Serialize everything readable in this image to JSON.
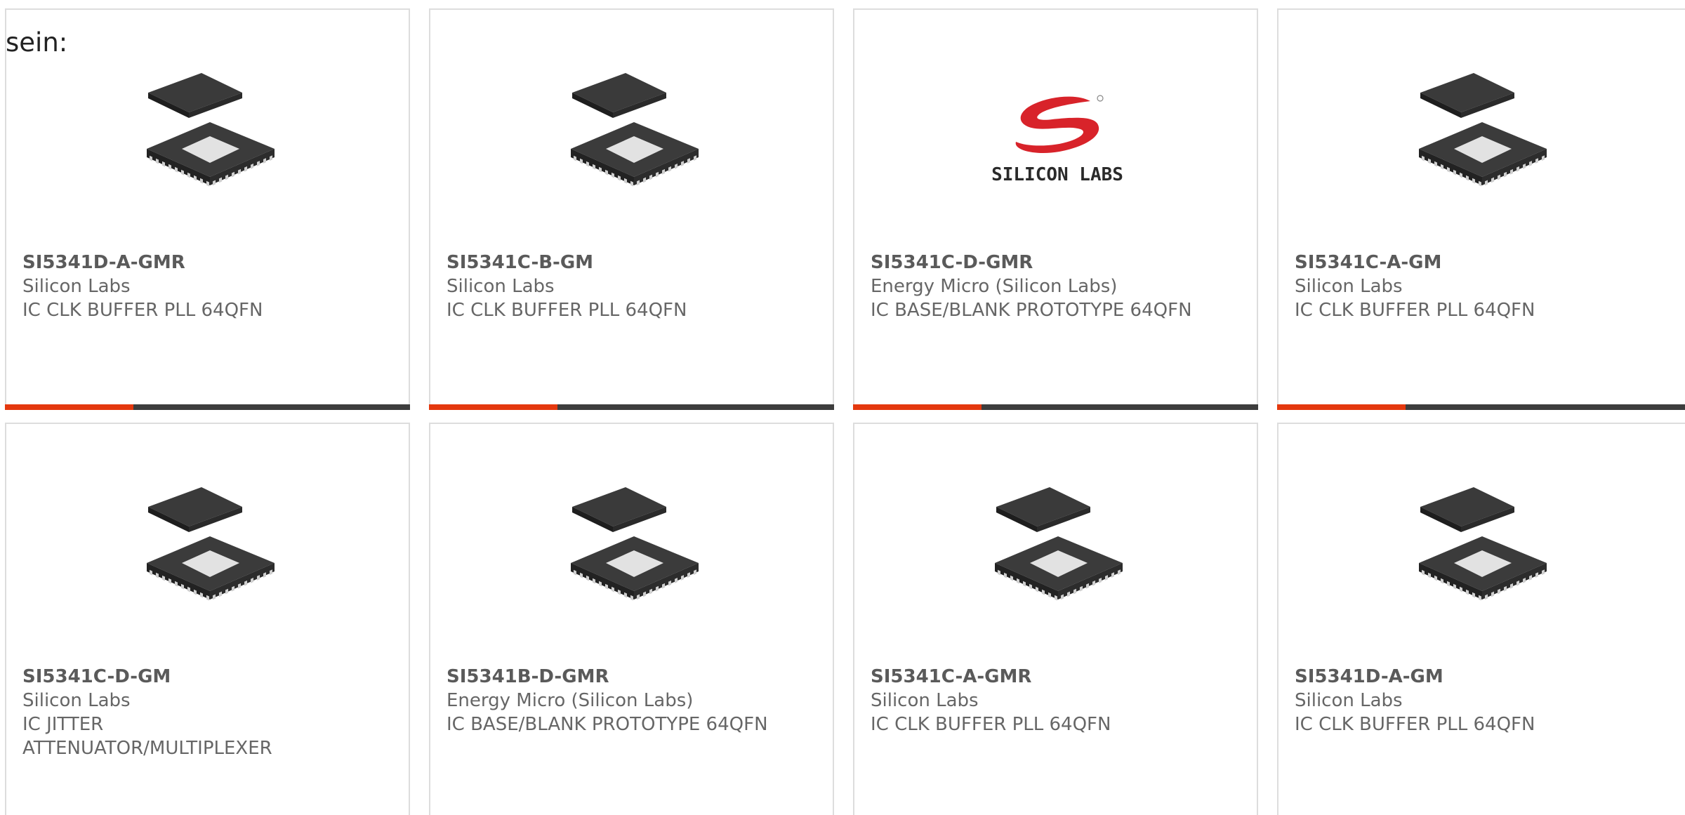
{
  "intro_text": "sein:",
  "colors": {
    "accent_bar": "#e4380e",
    "base_bar": "#3d3d3d",
    "logo_red": "#d8232a"
  },
  "cards": [
    {
      "part_number": "SI5341D-A-GMR",
      "manufacturer": "Silicon Labs",
      "description": "IC CLK BUFFER PLL 64QFN",
      "image": "qfn-chip-icon"
    },
    {
      "part_number": "SI5341C-B-GM",
      "manufacturer": "Silicon Labs",
      "description": "IC CLK BUFFER PLL 64QFN",
      "image": "qfn-chip-icon"
    },
    {
      "part_number": "SI5341C-D-GMR",
      "manufacturer": "Energy Micro (Silicon Labs)",
      "description": "IC BASE/BLANK PROTOTYPE 64QFN",
      "image": "silicon-labs-logo",
      "logo_text": "SILICON LABS"
    },
    {
      "part_number": "SI5341C-A-GM",
      "manufacturer": "Silicon Labs",
      "description": "IC CLK BUFFER PLL 64QFN",
      "image": "qfn-chip-icon"
    },
    {
      "part_number": "SI5341C-D-GM",
      "manufacturer": "Silicon Labs",
      "description": "IC JITTER ATTENUATOR/MULTIPLEXER",
      "image": "qfn-chip-icon"
    },
    {
      "part_number": "SI5341B-D-GMR",
      "manufacturer": "Energy Micro (Silicon Labs)",
      "description": "IC BASE/BLANK PROTOTYPE 64QFN",
      "image": "qfn-chip-icon"
    },
    {
      "part_number": "SI5341C-A-GMR",
      "manufacturer": "Silicon Labs",
      "description": "IC CLK BUFFER PLL 64QFN",
      "image": "qfn-chip-icon"
    },
    {
      "part_number": "SI5341D-A-GM",
      "manufacturer": "Silicon Labs",
      "description": "IC CLK BUFFER PLL 64QFN",
      "image": "qfn-chip-icon"
    }
  ]
}
